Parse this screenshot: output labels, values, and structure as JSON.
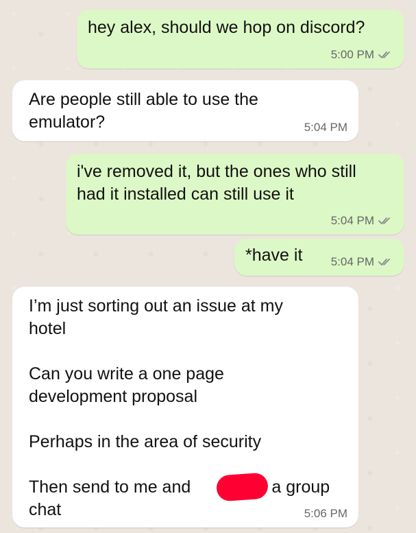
{
  "messages": [
    {
      "direction": "outgoing",
      "text": "hey alex, should we hop on discord?",
      "time": "5:00 PM",
      "status": "read"
    },
    {
      "direction": "incoming",
      "text": "Are people still able to use the\nemulator?",
      "time": "5:04 PM"
    },
    {
      "direction": "outgoing",
      "text": "i've removed it, but the ones who still\nhad it installed can still use it",
      "time": "5:04 PM",
      "status": "read"
    },
    {
      "direction": "outgoing",
      "text": "*have it",
      "time": "5:04 PM",
      "status": "read"
    },
    {
      "direction": "incoming",
      "text": "I’m just sorting out an issue at my\nhotel\n\nCan you write a one page\ndevelopment proposal\n\nPerhaps in the area of security\n\nThen send to me and            on a group\nchat",
      "time": "5:06 PM"
    }
  ],
  "colors": {
    "outgoing_bubble": "#dcf8c6",
    "incoming_bubble": "#ffffff",
    "background": "#ece5dd",
    "tick": "#8a8a8a",
    "redaction": "#ff0033"
  },
  "icons": {
    "read_status": "double-check-icon"
  }
}
